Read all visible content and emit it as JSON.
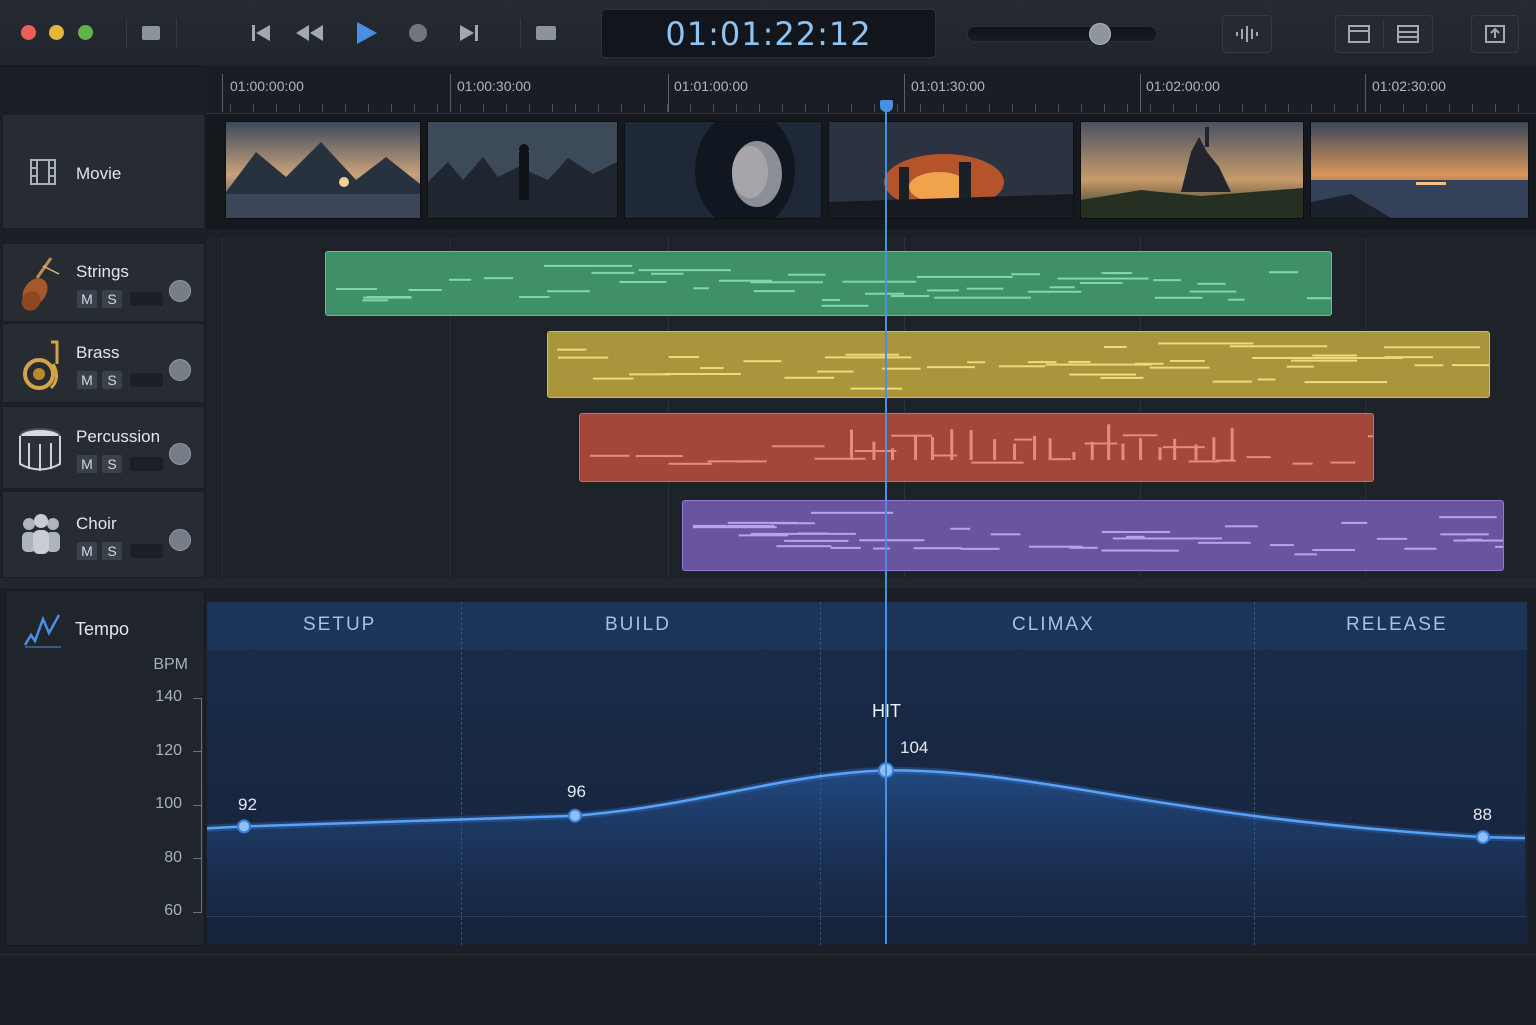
{
  "toolbar": {
    "timecode": "01:01:22:12",
    "buttons": [
      "stop-square",
      "skip-to-start",
      "rewind",
      "play",
      "record",
      "skip-to-end",
      "loop"
    ],
    "volume": 0.7,
    "accent": "#4a90e2"
  },
  "ruler": {
    "labels": [
      "01:00:00:00",
      "01:00:30:00",
      "01:01:00:00",
      "01:01:30:00",
      "01:02:00:00",
      "01:02:30:00"
    ]
  },
  "movie": {
    "name": "Movie",
    "frames": [
      "mountain lake at sunset",
      "lone figure among ruins",
      "woman portrait",
      "burning castle",
      "castle at dusk",
      "sea at sunset"
    ]
  },
  "tracks": [
    {
      "name": "Strings",
      "icon": "violin-icon",
      "mute": "M",
      "solo": "S",
      "color": "#4aa57a"
    },
    {
      "name": "Brass",
      "icon": "tuba-icon",
      "mute": "M",
      "solo": "S",
      "color": "#b8a040"
    },
    {
      "name": "Percussion",
      "icon": "drum-icon",
      "mute": "M",
      "solo": "S",
      "color": "#b85a4c"
    },
    {
      "name": "Choir",
      "icon": "people-icon",
      "mute": "M",
      "solo": "S",
      "color": "#7f62b8"
    }
  ],
  "tempo": {
    "name": "Tempo",
    "unit": "BPM",
    "yticks": [
      "140",
      "120",
      "100",
      "80",
      "60"
    ],
    "sections": [
      "SETUP",
      "BUILD",
      "CLIMAX",
      "RELEASE"
    ],
    "hit_label": "HIT",
    "points": [
      {
        "label": "92",
        "bpm": 92
      },
      {
        "label": "96",
        "bpm": 96
      },
      {
        "label": "104",
        "bpm": 113
      },
      {
        "label": "88",
        "bpm": 88
      }
    ]
  }
}
